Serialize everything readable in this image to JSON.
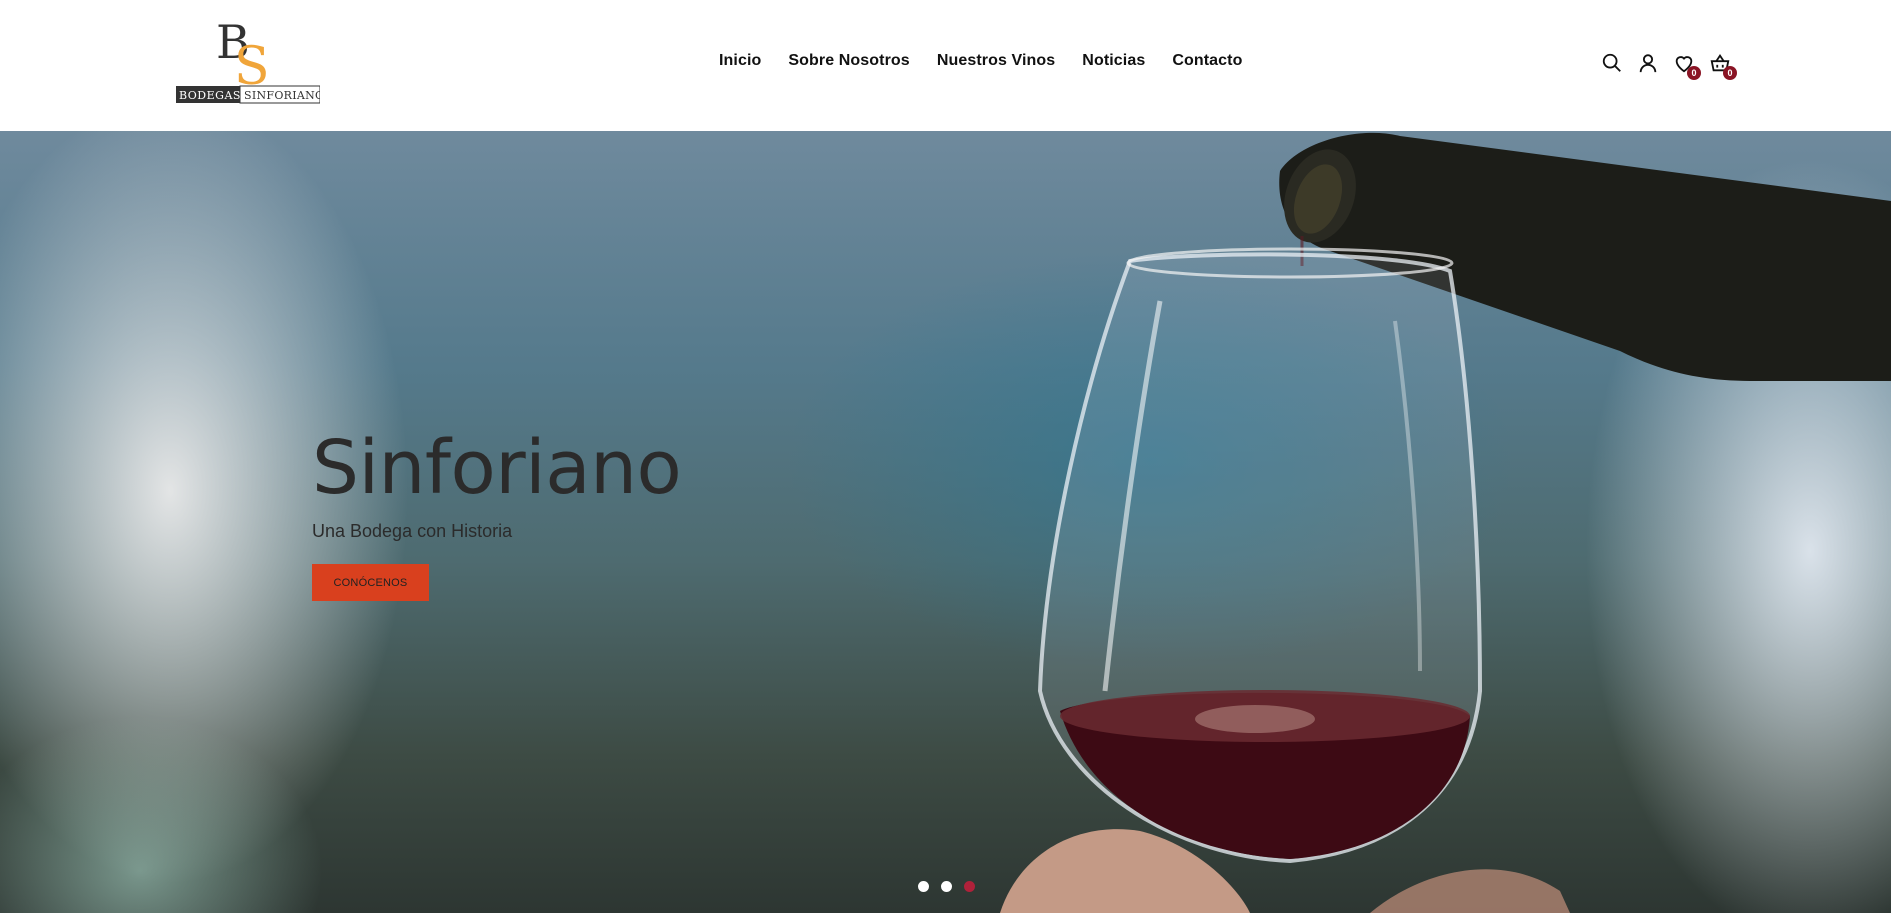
{
  "brand": {
    "logo_monogram": "BS",
    "logo_word1": "Bodegas",
    "logo_word2": "Sinforiano",
    "accent_color": "#f0a53a",
    "dark_color": "#333333"
  },
  "nav": {
    "items": [
      {
        "label": "Inicio"
      },
      {
        "label": "Sobre Nosotros"
      },
      {
        "label": "Nuestros Vinos"
      },
      {
        "label": "Noticias"
      },
      {
        "label": "Contacto"
      }
    ]
  },
  "header_icons": {
    "search": {
      "icon": "search-icon"
    },
    "account": {
      "icon": "user-icon"
    },
    "wishlist": {
      "icon": "heart-icon",
      "count": "0"
    },
    "cart": {
      "icon": "basket-icon",
      "count": "0"
    },
    "badge_color": "#8a1424"
  },
  "hero": {
    "title": "Sinforiano",
    "subtitle": "Una Bodega con Historia",
    "button_label": "CONÓCENOS",
    "button_color": "#d9401e",
    "slides_total": 3,
    "active_slide": 3,
    "active_dot_color": "#b0213a"
  }
}
